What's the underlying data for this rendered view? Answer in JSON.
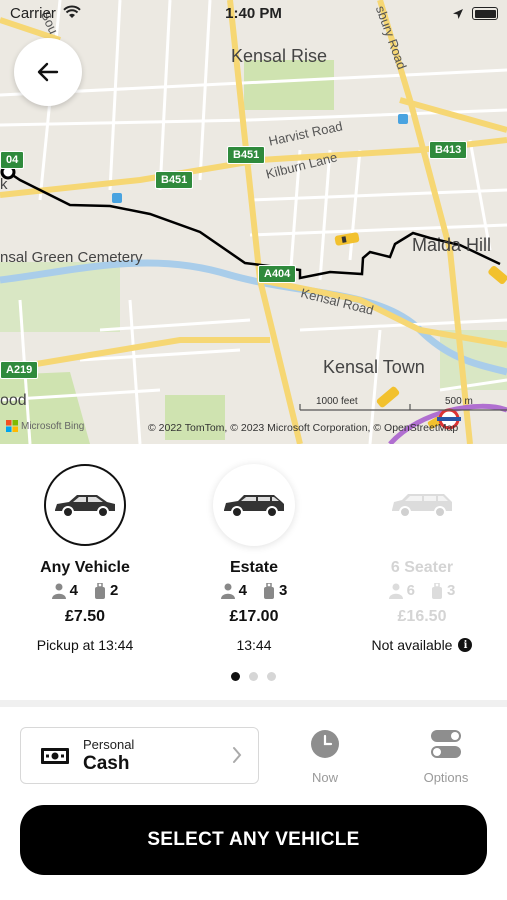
{
  "status_bar": {
    "carrier": "Carrier",
    "time": "1:40 PM",
    "icons": [
      "wifi-icon",
      "location-arrow-icon",
      "battery-icon"
    ]
  },
  "map": {
    "labels": {
      "kensal_rise": "Kensal Rise",
      "harvist_road": "Harvist Road",
      "kilburn_lane": "Kilburn Lane",
      "kensal_green_cemetery": "nsal Green Cemetery",
      "maida_hill": "Maida Hill",
      "kensal_road": "Kensal Road",
      "kensal_town": "Kensal Town",
      "ood": "ood",
      "k": "k",
      "salusbury_road": "sbury Road",
      "south": "Sou"
    },
    "shields": {
      "b451_a": "B451",
      "b451_b": "B451",
      "b413": "B413",
      "a404": "A404",
      "a219": "A219",
      "b04": "04"
    },
    "scale": {
      "feet": "1000 feet",
      "meters": "500 m"
    },
    "provider": "Microsoft Bing",
    "copyright": "© 2022 TomTom, © 2023 Microsoft Corporation, © OpenStreetMap",
    "route_color": "#000000"
  },
  "vehicles": [
    {
      "name": "Any Vehicle",
      "passengers": "4",
      "luggage": "2",
      "price": "£7.50",
      "pickup": "Pickup at 13:44",
      "selected": true,
      "available": true
    },
    {
      "name": "Estate",
      "passengers": "4",
      "luggage": "3",
      "price": "£17.00",
      "pickup": "13:44",
      "selected": false,
      "available": true
    },
    {
      "name": "6 Seater",
      "passengers": "6",
      "luggage": "3",
      "price": "£16.50",
      "pickup": "Not available",
      "selected": false,
      "available": false
    }
  ],
  "carousel": {
    "pages": 3,
    "current": 1
  },
  "payment": {
    "type": "Personal",
    "method": "Cash"
  },
  "tools": {
    "now_label": "Now",
    "options_label": "Options"
  },
  "select_button": "SELECT ANY VEHICLE",
  "colors": {
    "accent": "#000000",
    "map_major_road": "#f6d774",
    "map_park": "#cfe3b0",
    "map_water": "#a9cdea",
    "taxi": "#f2c12e"
  }
}
